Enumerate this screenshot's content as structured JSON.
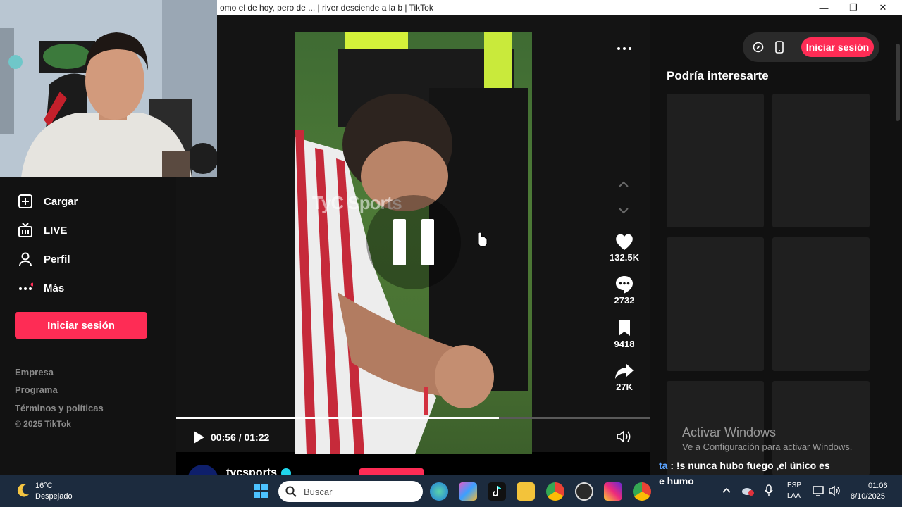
{
  "window": {
    "title": "omo el de hoy, pero de ... | river desciende a la b | TikTok",
    "minimize": "—",
    "restore": "❐",
    "close": "✕"
  },
  "sidebar": {
    "items": [
      {
        "label": "Cargar",
        "icon": "upload-icon"
      },
      {
        "label": "LIVE",
        "icon": "live-icon"
      },
      {
        "label": "Perfil",
        "icon": "profile-icon"
      },
      {
        "label": "Más",
        "icon": "more-icon"
      }
    ],
    "login": "Iniciar sesión",
    "footer": [
      "Empresa",
      "Programa",
      "Términos y políticas"
    ],
    "copyright": "© 2025 TikTok"
  },
  "video": {
    "watermark": "TyC Sports",
    "time_display": "00:56 / 01:22",
    "progress": 0.68
  },
  "actions": {
    "likes": "132.5K",
    "comments": "2732",
    "saves": "9418",
    "shares": "27K"
  },
  "author": {
    "username": "tycsports"
  },
  "right": {
    "login": "Iniciar sesión",
    "section_title": "Podría interesarte"
  },
  "overlay": {
    "activate_title": "Activar Windows",
    "activate_sub": "Ve a Configuración para activar Windows.",
    "chat_line1_prefix": "ta",
    "chat_line1": " : !s nunca hubo fuego ,el único es",
    "chat_line2": "e humo"
  },
  "taskbar": {
    "temp": "16°C",
    "weather": "Despejado",
    "search_placeholder": "Buscar",
    "lang_top": "ESP",
    "lang_bottom": "LAA",
    "time": "01:06",
    "date": "8/10/2025"
  },
  "colors": {
    "accent": "#fe2c55",
    "taskbar": "#1c2b3e"
  }
}
